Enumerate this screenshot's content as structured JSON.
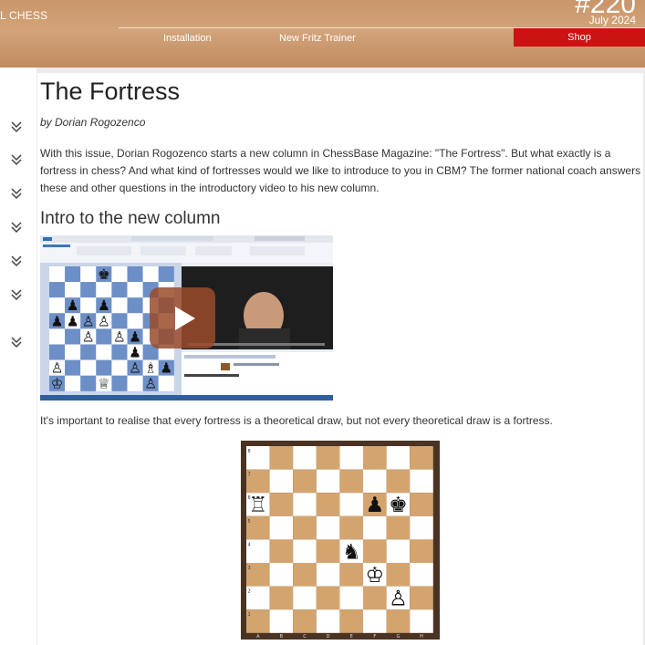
{
  "header": {
    "brand": "L CHESS",
    "issue_number": "#220",
    "issue_date": "July 2024",
    "nav": [
      "Installation",
      "New Fritz Trainer"
    ],
    "shop_label": "Shop"
  },
  "article": {
    "title": "The Fortress",
    "author": "by Dorian Rogozenco",
    "intro": "With this issue, Dorian Rogozenco starts a new column in ChessBase Magazine: \"The Fortress\". But what exactly is a fortress in chess? And what kind of fortresses would we like to introduce to you in CBM? The former national coach answers these and other questions in the introductory video to his new column.",
    "section_heading": "Intro to the new column",
    "statement": "It's important to realise that every fortress is a theoretical draw, but not every theoretical draw is a fortress."
  },
  "sidebar": {
    "icons": [
      "chevron-double-down-icon",
      "chevron-double-down-icon",
      "chevron-double-down-icon",
      "chevron-double-down-icon",
      "chevron-double-down-icon",
      "chevron-double-down-icon",
      "chevron-double-down-icon"
    ]
  },
  "video": {
    "play_icon": "play-icon",
    "board_position": [
      "...k....",
      "........",
      ".p.p....",
      "ppPP....",
      "..P.Pp..",
      ".....p..",
      "P....PBp",
      "K..Q..P."
    ]
  },
  "diagram": {
    "files": [
      "a",
      "b",
      "c",
      "d",
      "e",
      "f",
      "g",
      "h"
    ],
    "ranks": [
      "8",
      "7",
      "6",
      "5",
      "4",
      "3",
      "2",
      "1"
    ],
    "position": [
      "........",
      "........",
      "R....pk.",
      "........",
      "....n...",
      ".....K..",
      "......P.",
      "........"
    ],
    "colors": {
      "light": "#ffffff",
      "dark": "#d4a46f"
    }
  }
}
